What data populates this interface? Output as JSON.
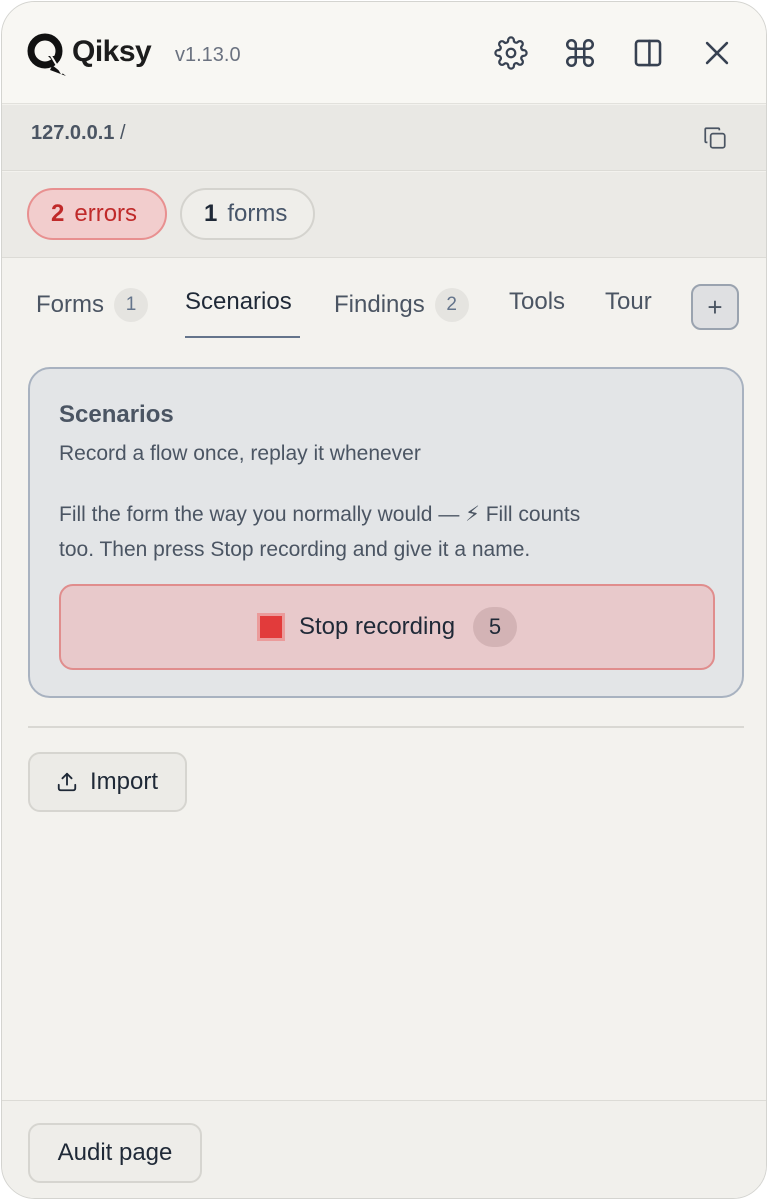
{
  "header": {
    "brand": "Qiksy",
    "version": "v1.13.0",
    "icons": [
      "gear-icon",
      "command-icon",
      "sidebar-panel-icon",
      "close-icon"
    ]
  },
  "urlbar": {
    "host": "127.0.0.1",
    "path": "/"
  },
  "status": {
    "errors_count": "2",
    "errors_label": "errors",
    "forms_count": "1",
    "forms_label": "forms"
  },
  "tabs": [
    {
      "label": "Forms",
      "count": "1"
    },
    {
      "label": "Scenarios"
    },
    {
      "label": "Findings",
      "count": "2"
    },
    {
      "label": "Tools"
    },
    {
      "label": "Tour"
    }
  ],
  "tabs_add_label": "+",
  "active_tab": "Scenarios",
  "scenarios": {
    "title": "Scenarios",
    "subtitle": "Record a flow once, replay it whenever",
    "description_line1": "Fill the form the way you normally would — ⚡ Fill counts",
    "description_line2": "too. Then press Stop recording and give it a name.",
    "stop_label": "Stop recording",
    "step_count": "5"
  },
  "import_label": "Import",
  "footer": {
    "audit_label": "Audit page"
  },
  "colors": {
    "error": "#c02a2a",
    "stop_fill": "#e23b3b",
    "accent_underline": "#64748b"
  }
}
